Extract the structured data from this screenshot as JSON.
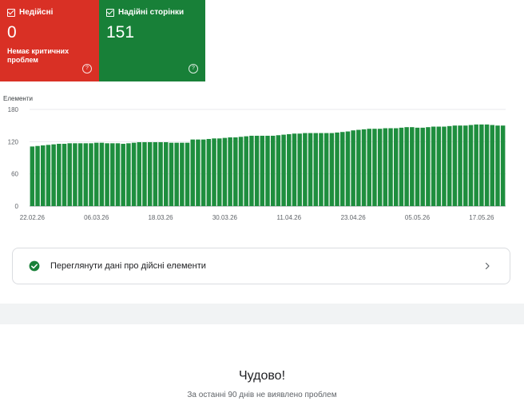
{
  "cards": {
    "invalid": {
      "label": "Недійсні",
      "count": "0",
      "subtitle": "Немає критичних проблем",
      "help": "?"
    },
    "valid": {
      "label": "Надійні сторінки",
      "count": "151",
      "help": "?"
    }
  },
  "chart_data": {
    "type": "bar",
    "title": "",
    "ylabel": "Елементи",
    "xlabel": "",
    "ylim": [
      0,
      180
    ],
    "yticks": [
      0,
      60,
      120,
      180
    ],
    "color": "#1e8e3e",
    "x_tick_labels": [
      "22.02.26",
      "06.03.26",
      "18.03.26",
      "30.03.26",
      "11.04.26",
      "23.04.26",
      "05.05.26",
      "17.05.26"
    ],
    "x_tick_positions": [
      0,
      12,
      24,
      36,
      48,
      60,
      72,
      84
    ],
    "values": [
      111,
      112,
      113,
      114,
      115,
      116,
      116,
      117,
      117,
      117,
      117,
      117,
      118,
      118,
      117,
      117,
      117,
      116,
      117,
      118,
      119,
      119,
      119,
      119,
      119,
      119,
      118,
      118,
      118,
      118,
      124,
      124,
      124,
      125,
      126,
      126,
      127,
      128,
      128,
      129,
      130,
      131,
      131,
      131,
      131,
      131,
      132,
      133,
      134,
      135,
      135,
      136,
      136,
      136,
      136,
      136,
      136,
      137,
      138,
      139,
      141,
      142,
      143,
      144,
      144,
      144,
      145,
      145,
      145,
      146,
      147,
      147,
      146,
      146,
      147,
      148,
      148,
      148,
      149,
      150,
      150,
      150,
      151,
      152,
      152,
      152,
      151,
      150,
      150
    ]
  },
  "action_row": {
    "label": "Переглянути дані про дійсні елементи"
  },
  "status": {
    "headline": "Чудово!",
    "subtext": "За останні 90 днів не виявлено проблем"
  }
}
